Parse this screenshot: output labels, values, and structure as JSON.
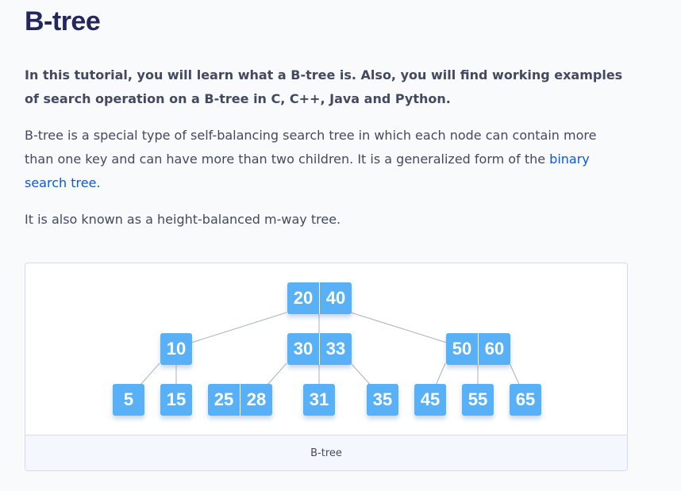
{
  "page": {
    "title": "B-tree",
    "intro": "In this tutorial, you will learn what a B-tree is. Also, you will find working examples of search operation on a B-tree in C, C++, Java and Python.",
    "definition_text": "B-tree is a special type of self-balancing search tree in which each node can contain more than one key and can have more than two children. It is a generalized form of the ",
    "definition_link": "binary search tree.",
    "aka": "It is also known as a height-balanced m-way tree."
  },
  "figure": {
    "caption": "B-tree",
    "colors": {
      "node": "#58b1f6",
      "edge": "#aab2bc",
      "key_text": "#ffffff"
    },
    "tree": {
      "root": [
        "20",
        "40"
      ],
      "level1": [
        [
          "10"
        ],
        [
          "30",
          "33"
        ],
        [
          "50",
          "60"
        ]
      ],
      "leaves": [
        [
          "5"
        ],
        [
          "15"
        ],
        [
          "25",
          "28"
        ],
        [
          "31"
        ],
        [
          "35"
        ],
        [
          "45"
        ],
        [
          "55"
        ],
        [
          "65"
        ]
      ]
    }
  }
}
